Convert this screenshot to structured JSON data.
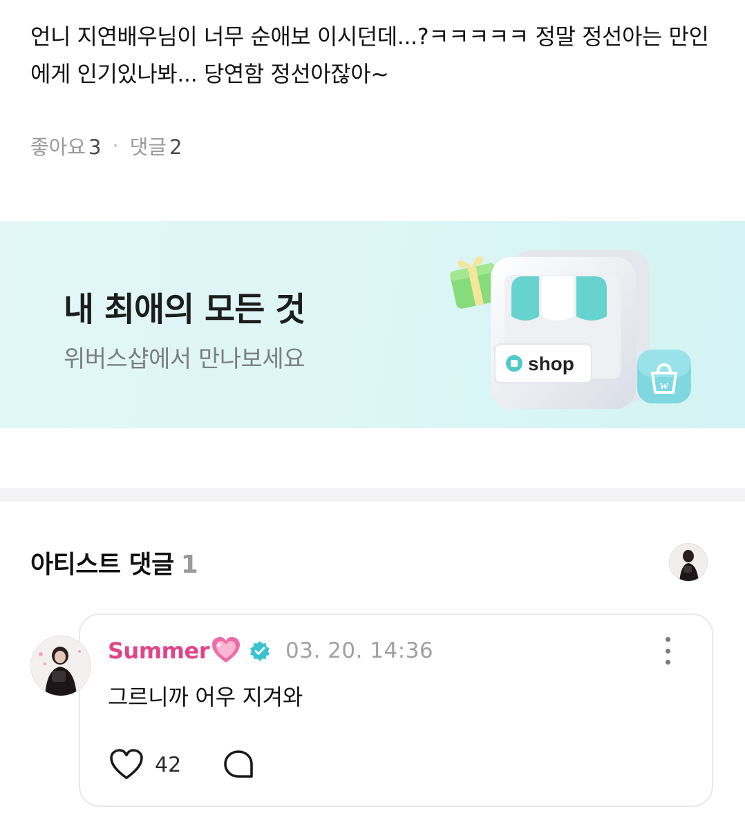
{
  "post": {
    "body": "언니 지연배우님이 너무 순애보 이시던데...?ㅋㅋㅋㅋㅋ 정말 정선아는 만인에게 인기있나봐... 당연함 정선아잖아~",
    "likes_label": "좋아요",
    "likes_count": "3",
    "separator": "·",
    "comments_label": "댓글",
    "comments_count": "2"
  },
  "banner": {
    "title": "내 최애의 모든 것",
    "subtitle": "위버스샵에서 만나보세요",
    "shop_sign": "shop",
    "bag_letter": "w",
    "icons": [
      "gift-icon",
      "storefront-icon",
      "shopping-bag-icon"
    ]
  },
  "artist_comments": {
    "title": "아티스트 댓글",
    "count": "1"
  },
  "comment": {
    "author": "Summer",
    "timestamp": "03. 20. 14:36",
    "text": "그르니까 어우 지겨와",
    "like_count": "42",
    "icons": [
      "sparkling-heart-icon",
      "verified-badge-icon",
      "more-vertical-icon",
      "heart-outline-icon",
      "speech-bubble-icon"
    ]
  },
  "colors": {
    "author_name": "#e0458a",
    "verified_badge": "#38c3cf",
    "banner_bg": "#def6f6",
    "accent_mint": "#5fd1cd"
  }
}
